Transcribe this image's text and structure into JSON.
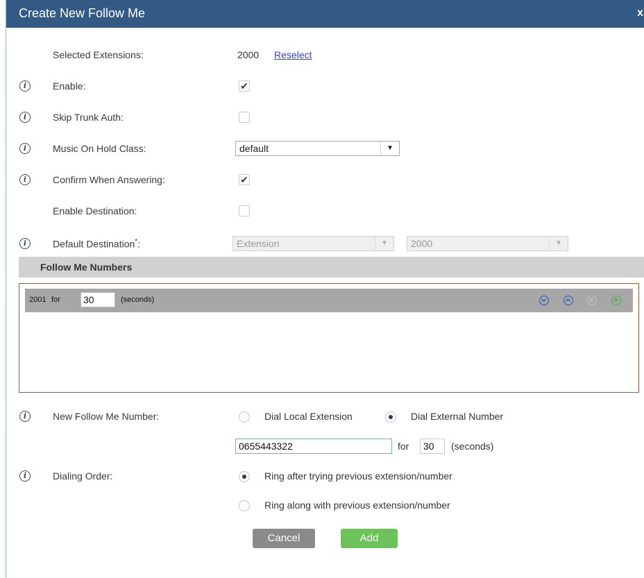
{
  "dialog": {
    "title": "Create New Follow Me",
    "close_label": "x"
  },
  "form": {
    "selected_extensions": {
      "label": "Selected Extensions:",
      "value": "2000",
      "link": "Reselect"
    },
    "enable": {
      "label": "Enable:",
      "checked": true
    },
    "skip_trunk_auth": {
      "label": "Skip Trunk Auth:",
      "checked": false
    },
    "music_on_hold": {
      "label": "Music On Hold Class:",
      "value": "default"
    },
    "confirm_when_answering": {
      "label": "Confirm When Answering:",
      "checked": true
    },
    "enable_destination": {
      "label": "Enable Destination:",
      "checked": false
    },
    "default_destination": {
      "label": "Default Destination",
      "required_mark": "*",
      "label_suffix": ":",
      "type_value": "Extension",
      "number_value": "2000"
    }
  },
  "follow_me_numbers": {
    "title": "Follow Me Numbers",
    "items": [
      {
        "number": "2001",
        "for_label": "for",
        "seconds": "30",
        "unit": "(seconds)"
      }
    ]
  },
  "new_number": {
    "label": "New Follow Me Number:",
    "options": [
      "Dial Local Extension",
      "Dial External Number"
    ],
    "selected": "Dial External Number",
    "number_value": "0655443322",
    "for_label": "for",
    "seconds": "30",
    "unit": "(seconds)"
  },
  "dialing_order": {
    "label": "Dialing Order:",
    "options": [
      "Ring after trying previous extension/number",
      "Ring along with previous extension/number"
    ],
    "selected": "Ring after trying previous extension/number"
  },
  "buttons": {
    "cancel": "Cancel",
    "add": "Add"
  },
  "icons": {
    "check": "✔",
    "info": "i",
    "dropdown": "▼"
  },
  "colors": {
    "titlebar": "#325a84",
    "cancel": "#8a8a8a",
    "add": "#6cc35a",
    "move_icons": "#2a5bbd",
    "add_icon": "#4cb04c"
  }
}
